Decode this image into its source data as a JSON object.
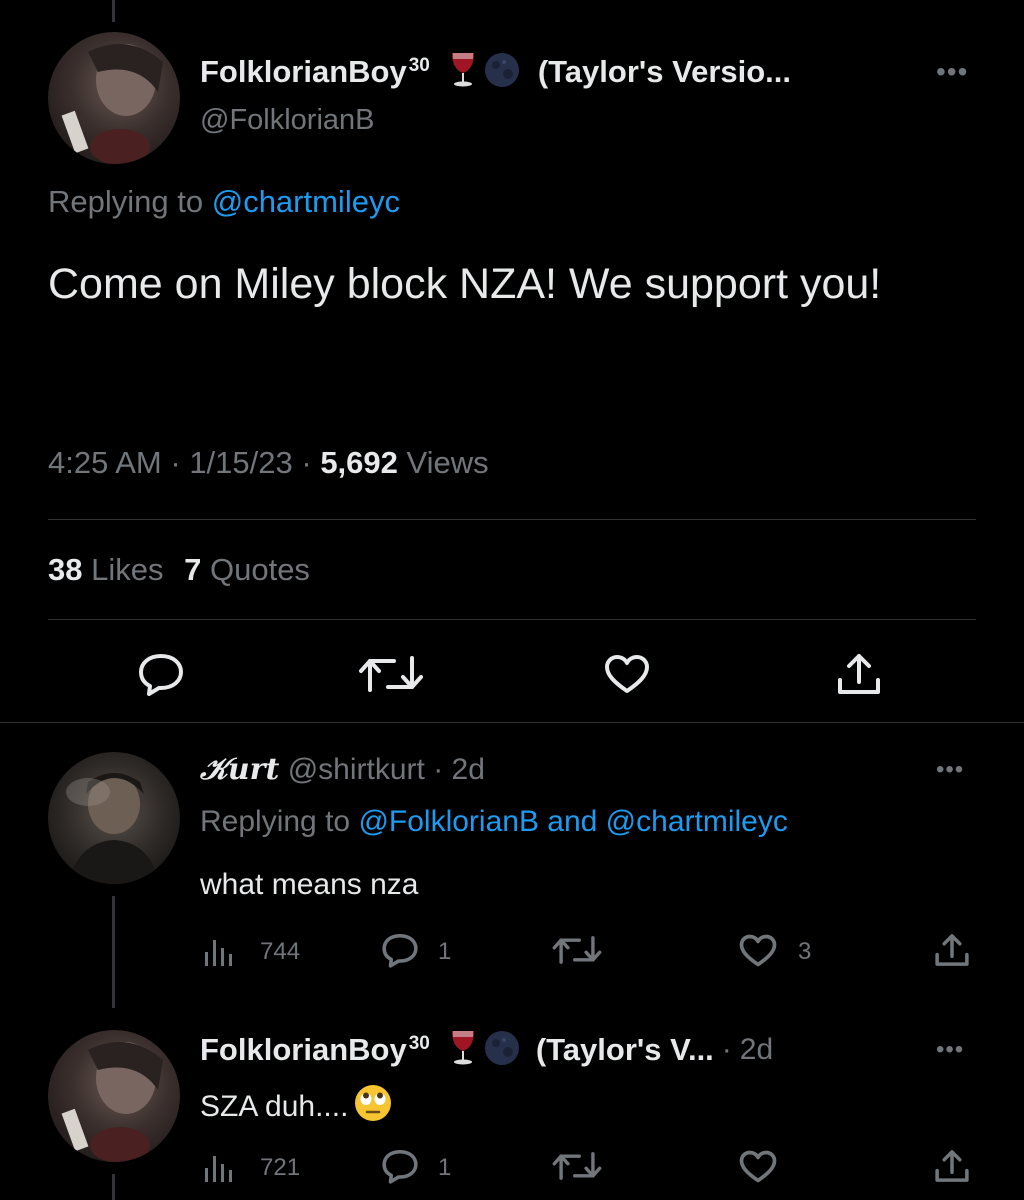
{
  "main_tweet": {
    "display_name": "FolkloriánBoy",
    "display_name_sup": "30",
    "name_suffix": "(Taylor's Versio...",
    "handle": "@FolklorianB",
    "replying_prefix": "Replying to",
    "replying_to": "@chartmileyc",
    "text": "Come on Miley block NZA! We support you!",
    "time": "4:25 AM",
    "date": "1/15/23",
    "views_count": "5,692",
    "views_label": "Views",
    "likes_count": "38",
    "likes_label": "Likes",
    "quotes_count": "7",
    "quotes_label": "Quotes"
  },
  "reply_1": {
    "display_name": "𝒦urt",
    "handle": "@shirtkurt",
    "time": "2d",
    "replying_prefix": "Replying to",
    "replying_to": "@FolklorianB and @chartmileyc",
    "text": "what means nza",
    "views": "744",
    "replies": "1",
    "likes": "3"
  },
  "reply_2": {
    "display_name": "FolklorianBoy",
    "display_name_sup": "30",
    "name_suffix": "(Taylor's V...",
    "time": "2d",
    "text": "SZA duh....",
    "views": "721",
    "replies": "1"
  },
  "colors": {
    "accent": "#1d9bf0",
    "muted": "#71767b",
    "text": "#e7e9ea",
    "background": "#000000"
  },
  "icons": [
    "more-icon",
    "reply-icon",
    "retweet-icon",
    "like-icon",
    "share-icon",
    "views-icon",
    "wine-glass-icon",
    "moon-icon",
    "eye-roll-emoji-icon"
  ]
}
